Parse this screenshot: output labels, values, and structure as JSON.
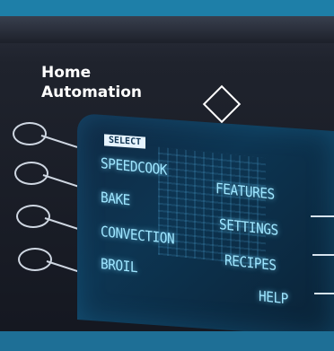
{
  "title": {
    "line1": "Home",
    "line2": "Automation"
  },
  "screen": {
    "select_badge": "SELECT",
    "left_menu": [
      "SPEEDCOOK",
      "BAKE",
      "CONVECTION",
      "BROIL"
    ],
    "right_menu": [
      "FEATURES",
      "SETTINGS",
      "RECIPES",
      "HELP"
    ]
  },
  "colors": {
    "top_bar": "#1e7fa8",
    "screen_text": "#9fe6ff",
    "title_text": "#ffffff"
  },
  "icons": [
    "diamond-icon",
    "knob-icon"
  ]
}
